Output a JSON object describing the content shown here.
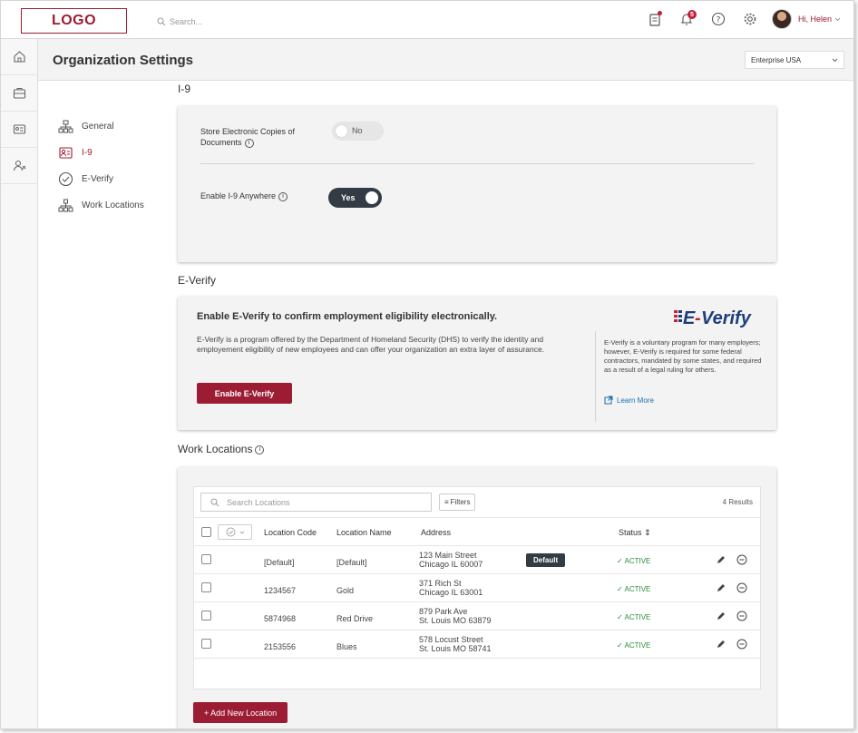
{
  "topbar": {
    "logo": "LOGO",
    "search_placeholder": "Search...",
    "notification_count": "5",
    "user_greeting": "Hi, Helen"
  },
  "header": {
    "title": "Organization Settings",
    "org_select": "Enterprise USA"
  },
  "sidenav": [
    {
      "label": "General",
      "icon": "org-chart-icon"
    },
    {
      "label": "I-9",
      "icon": "id-card-icon"
    },
    {
      "label": "E-Verify",
      "icon": "check-circle-icon"
    },
    {
      "label": "Work Locations",
      "icon": "sitemap-icon"
    }
  ],
  "i9": {
    "section_title": "I-9",
    "store_label_line1": "Store Electronic Copies of",
    "store_label_line2": "Documents",
    "store_toggle": "No",
    "anywhere_label": "Enable I-9 Anywhere",
    "anywhere_toggle": "Yes"
  },
  "everify": {
    "section_title": "E-Verify",
    "heading": "Enable E-Verify to confirm employment eligibility electronically.",
    "body": "E-Verify is a program offered by the Department of Homeland Security (DHS) to verify the identity and employement eligibility of new employees and can offer your organization an extra layer of assurance.",
    "button": "Enable E-Verify",
    "logo_text": "E-Verify",
    "side_text": "E-Verify is a voluntary program for many employers; however, E-Verify is required for some federal contractors, mandated by some states, and required as a result of a legal ruling for others.",
    "learn_more": "Learn More"
  },
  "work_locations": {
    "section_title": "Work Locations",
    "search_placeholder": "Search Locations",
    "filters": "Filters",
    "results": "4 Results",
    "columns": {
      "code": "Location Code",
      "name": "Location Name",
      "address": "Address",
      "status": "Status"
    },
    "rows": [
      {
        "code": "[Default]",
        "name": "[Default]",
        "addr1": "123 Main Street",
        "addr2": "Chicago IL 60007",
        "badge": "Default",
        "status": "ACTIVE"
      },
      {
        "code": "1234567",
        "name": "Gold",
        "addr1": "371 Rich St",
        "addr2": "Chicago IL 63001",
        "badge": "",
        "status": "ACTIVE"
      },
      {
        "code": "5874968",
        "name": "Red Drive",
        "addr1": "879 Park Ave",
        "addr2": "St. Louis MO 63879",
        "badge": "",
        "status": "ACTIVE"
      },
      {
        "code": "2153556",
        "name": "Blues",
        "addr1": "578 Locust Street",
        "addr2": "St. Louis MO 58741",
        "badge": "",
        "status": "ACTIVE"
      }
    ],
    "add_button": "+ Add New Location"
  },
  "colors": {
    "brand": "#9c1c33",
    "dark": "#333b44",
    "active": "#2e8b3c"
  }
}
